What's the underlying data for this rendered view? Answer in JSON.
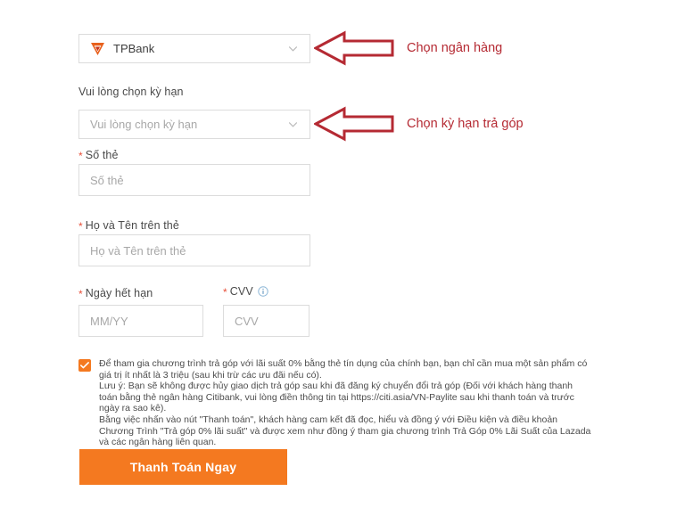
{
  "bank_select": {
    "name": "bank-select",
    "value": "TPBank",
    "logo_icon": "tpbank-logo-icon",
    "chevron_icon": "chevron-down-icon"
  },
  "term_field": {
    "label": "Vui lòng chọn kỳ hạn",
    "placeholder": "Vui lòng chọn kỳ hạn",
    "chevron_icon": "chevron-down-icon"
  },
  "card_number_field": {
    "required_mark": "*",
    "label": "Số thẻ",
    "placeholder": "Số thẻ",
    "value": ""
  },
  "card_holder_field": {
    "required_mark": "*",
    "label": "Họ và Tên trên thẻ",
    "placeholder": "Họ và Tên trên thẻ",
    "value": ""
  },
  "expiry_field": {
    "required_mark": "*",
    "label": "Ngày hết hạn",
    "placeholder": "MM/YY",
    "value": ""
  },
  "cvv_field": {
    "required_mark": "*",
    "label": "CVV",
    "placeholder": "CVV",
    "value": "",
    "info_icon": "info-circle-icon"
  },
  "terms": {
    "checked": true,
    "checkbox_icon": "checkmark-icon",
    "paragraph_1": "Để tham gia chương trình trả góp với lãi suất 0% bằng thẻ tín dụng của chính bạn, bạn chỉ cần mua một sản phẩm có giá trị ít nhất là 3 triệu (sau khi trừ các ưu đãi nếu có).",
    "paragraph_2": "Lưu ý: Bạn sẽ không được hủy giao dịch trả góp sau khi đã đăng ký chuyển đổi trả góp (Đối với khách hàng thanh toán bằng thẻ ngân hàng Citibank, vui lòng điền thông tin tại https://citi.asia/VN-Paylite sau khi thanh toán và trước ngày ra sao kê).",
    "paragraph_3": "Bằng việc nhấn vào nút \"Thanh toán\", khách hàng cam kết đã đọc, hiểu và đồng ý với Điều kiện và điều khoản Chương Trình \"Trả góp 0% lãi suất\" và được xem như đồng ý tham gia chương trình Trả Góp 0% Lãi Suất của Lazada và các ngân hàng liên quan."
  },
  "submit_button": {
    "label": "Thanh Toán Ngay"
  },
  "annotations": [
    {
      "text": "Chọn ngân hàng",
      "arrow_icon": "arrow-left-icon"
    },
    {
      "text": "Chọn kỳ hạn trả góp",
      "arrow_icon": "arrow-left-icon"
    }
  ],
  "colors": {
    "accent_orange": "#f47920",
    "annotation_red": "#b52a33",
    "required_red": "#e8503a",
    "border_gray": "#dcdcdc",
    "placeholder_gray": "#a8a8a8",
    "info_blue": "#8fb8d8"
  }
}
